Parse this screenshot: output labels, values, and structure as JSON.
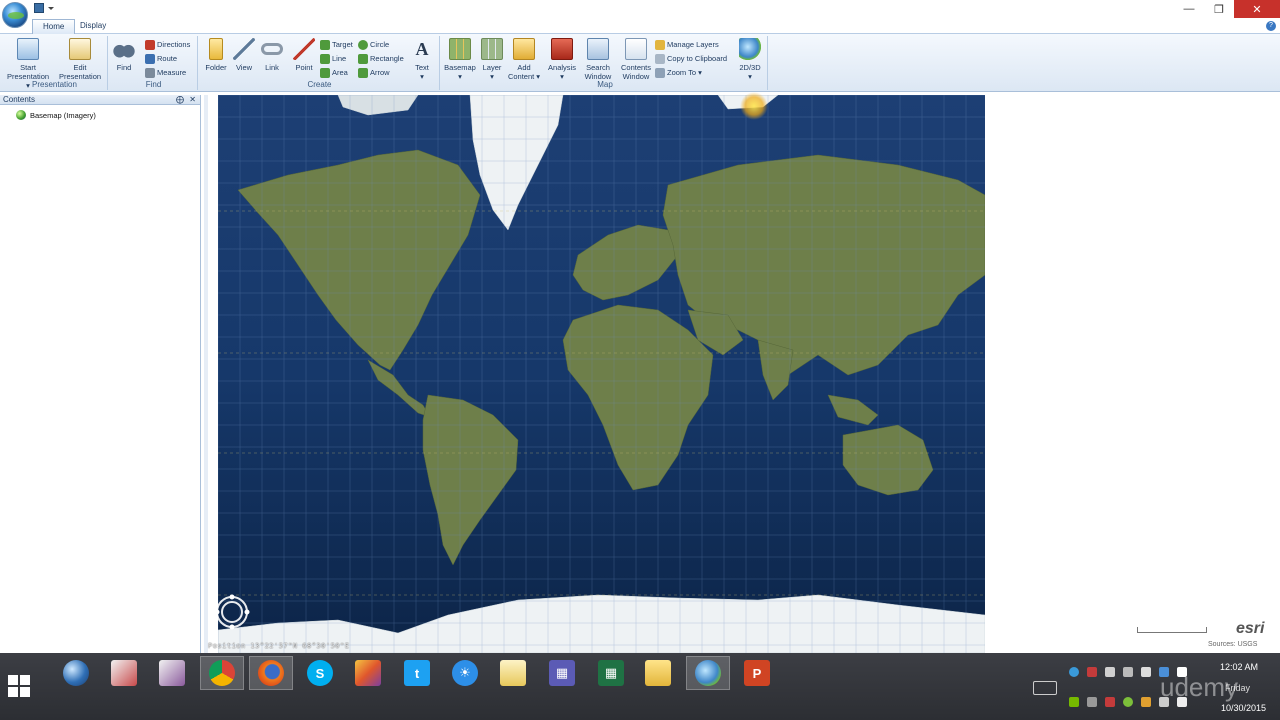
{
  "tabs": [
    {
      "label": "Home",
      "active": true
    },
    {
      "label": "Display",
      "active": false
    }
  ],
  "ribbon": {
    "groups": {
      "presentation": "Presentation",
      "find": "Find",
      "create": "Create",
      "map": "Map"
    },
    "presentation": {
      "start_line1": "Start",
      "start_line2": "Presentation ▾",
      "edit_line1": "Edit",
      "edit_line2": "Presentation"
    },
    "find": {
      "find": "Find",
      "directions": "Directions",
      "route": "Route",
      "measure": "Measure"
    },
    "create": {
      "folder": "Folder",
      "view": "View",
      "link": "Link",
      "point": "Point",
      "target": "Target",
      "line": "Line",
      "area": "Area",
      "circle": "Circle",
      "rectangle": "Rectangle",
      "arrow": "Arrow",
      "text": "Text",
      "text_arrow": "▾"
    },
    "map": {
      "basemap": "Basemap",
      "basemap_arrow": "▾",
      "layer": "Layer",
      "layer_arrow": "▾",
      "add_content_line1": "Add",
      "add_content_line2": "Content ▾",
      "analysis": "Analysis",
      "analysis_arrow": "▾",
      "search_line1": "Search",
      "search_line2": "Window",
      "contents_line1": "Contents",
      "contents_line2": "Window",
      "manage_layers": "Manage Layers",
      "copy_clipboard": "Copy to Clipboard",
      "zoom_to": "Zoom To ▾",
      "view_2d3d": "2D/3D",
      "view_2d3d_arrow": "▾"
    }
  },
  "contents_pane": {
    "title": "Contents",
    "pin": "⨁",
    "close": "✕",
    "layers": [
      {
        "label": "Basemap (Imagery)"
      }
    ]
  },
  "map": {
    "position": "Position 13°22'57\"N  68°30'50\"E",
    "attribution": "Sources: USGS",
    "logo": "esri"
  },
  "window_controls": {
    "minimize": "—",
    "maximize": "❐",
    "close": "✕"
  },
  "help": "?",
  "taskbar": {
    "time": "12:02 AM",
    "day": "Friday",
    "date": "10/30/2015",
    "watermark": "udemy"
  }
}
